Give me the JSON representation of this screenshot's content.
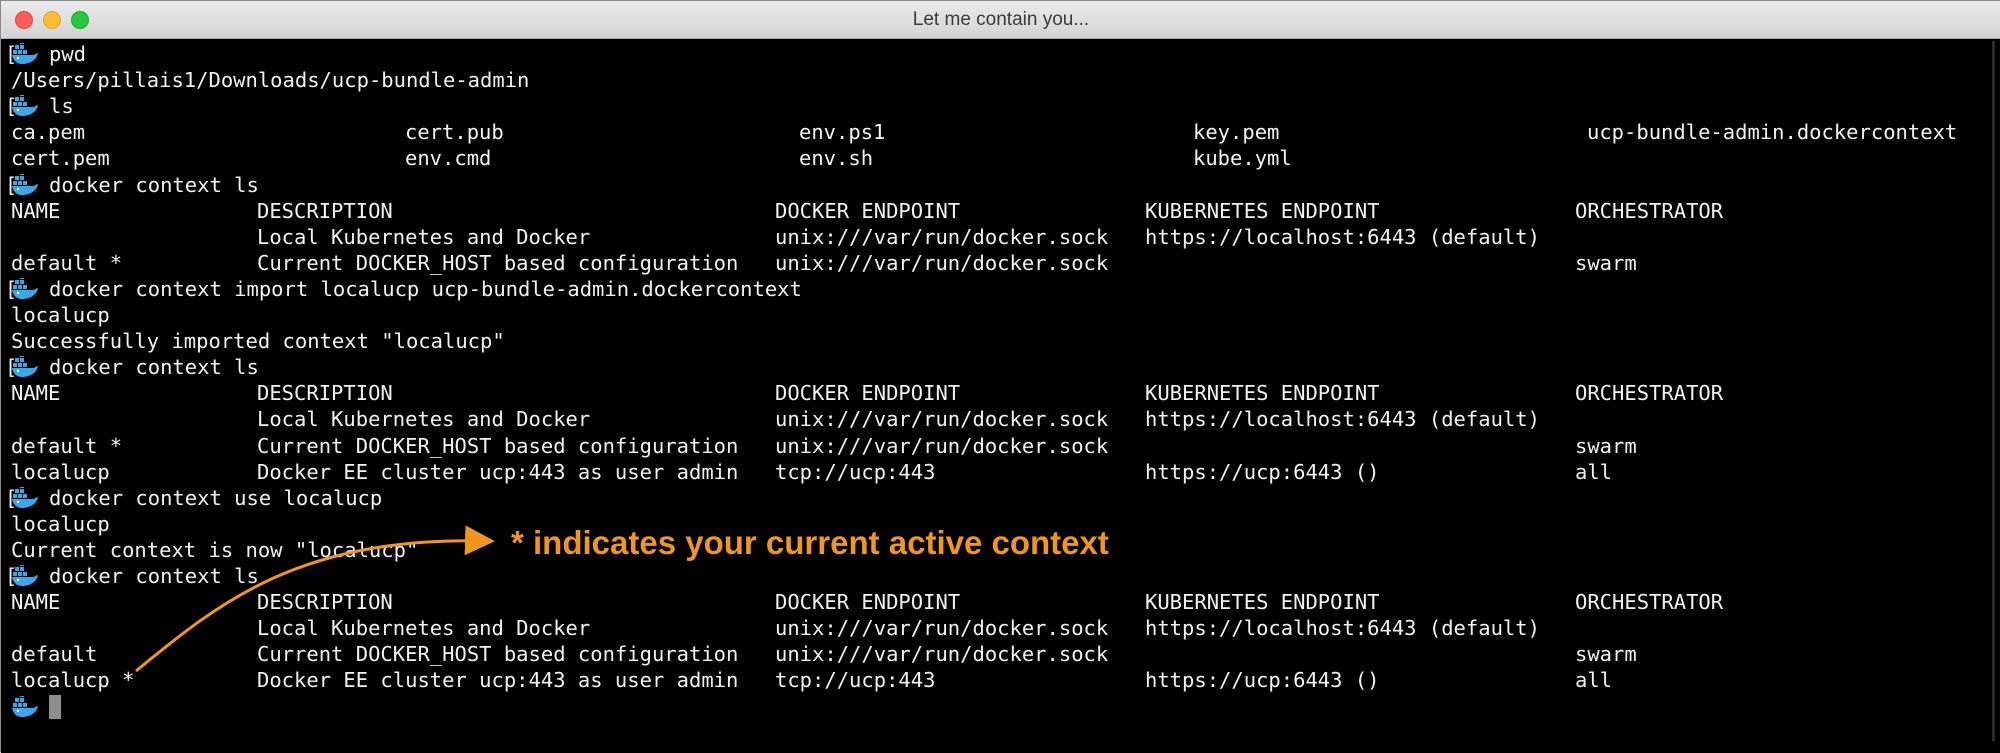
{
  "window": {
    "title": "Let me contain you..."
  },
  "prompt_icon": "docker-whale-icon",
  "session": [
    {
      "type": "cmd",
      "text": "pwd"
    },
    {
      "type": "out",
      "text": "/Users/pillais1/Downloads/ucp-bundle-admin"
    },
    {
      "type": "cmd",
      "text": "ls"
    },
    {
      "type": "cols",
      "cells": [
        "ca.pem",
        "cert.pub",
        "env.ps1",
        "key.pem",
        "ucp-bundle-admin.dockercontext"
      ]
    },
    {
      "type": "cols",
      "cells": [
        "cert.pem",
        "env.cmd",
        "env.sh",
        "kube.yml",
        ""
      ]
    },
    {
      "type": "cmd",
      "text": "docker context ls"
    },
    {
      "type": "ctx",
      "cells": [
        "NAME",
        "DESCRIPTION",
        "DOCKER ENDPOINT",
        "KUBERNETES ENDPOINT",
        "ORCHESTRATOR"
      ]
    },
    {
      "type": "ctx",
      "cells": [
        "",
        "Local Kubernetes and Docker",
        "unix:///var/run/docker.sock",
        "https://localhost:6443 (default)",
        ""
      ]
    },
    {
      "type": "ctx",
      "cells": [
        "default *",
        "Current DOCKER_HOST based configuration",
        "unix:///var/run/docker.sock",
        "",
        "swarm"
      ]
    },
    {
      "type": "cmd",
      "text": "docker context import localucp ucp-bundle-admin.dockercontext"
    },
    {
      "type": "out",
      "text": "localucp"
    },
    {
      "type": "out",
      "text": "Successfully imported context \"localucp\""
    },
    {
      "type": "cmd",
      "text": "docker context ls"
    },
    {
      "type": "ctx",
      "cells": [
        "NAME",
        "DESCRIPTION",
        "DOCKER ENDPOINT",
        "KUBERNETES ENDPOINT",
        "ORCHESTRATOR"
      ]
    },
    {
      "type": "ctx",
      "cells": [
        "",
        "Local Kubernetes and Docker",
        "unix:///var/run/docker.sock",
        "https://localhost:6443 (default)",
        ""
      ]
    },
    {
      "type": "ctx",
      "cells": [
        "default *",
        "Current DOCKER_HOST based configuration",
        "unix:///var/run/docker.sock",
        "",
        "swarm"
      ]
    },
    {
      "type": "ctx",
      "cells": [
        "localucp",
        "Docker EE cluster ucp:443 as user admin",
        "tcp://ucp:443",
        "https://ucp:6443 ()",
        "all"
      ]
    },
    {
      "type": "cmd",
      "text": "docker context use localucp"
    },
    {
      "type": "out",
      "text": "localucp"
    },
    {
      "type": "out",
      "text": "Current context is now \"localucp\""
    },
    {
      "type": "cmd",
      "text": "docker context ls"
    },
    {
      "type": "ctx",
      "cells": [
        "NAME",
        "DESCRIPTION",
        "DOCKER ENDPOINT",
        "KUBERNETES ENDPOINT",
        "ORCHESTRATOR"
      ]
    },
    {
      "type": "ctx",
      "cells": [
        "",
        "Local Kubernetes and Docker",
        "unix:///var/run/docker.sock",
        "https://localhost:6443 (default)",
        ""
      ]
    },
    {
      "type": "ctx",
      "cells": [
        "default",
        "Current DOCKER_HOST based configuration",
        "unix:///var/run/docker.sock",
        "",
        "swarm"
      ]
    },
    {
      "type": "ctx",
      "cells": [
        "localucp *",
        "Docker EE cluster ucp:443 as user admin",
        "tcp://ucp:443",
        "https://ucp:6443 ()",
        "all"
      ]
    },
    {
      "type": "prompt",
      "text": ""
    }
  ],
  "annotation": {
    "text": "* indicates your current active context",
    "color": "#f0961e"
  },
  "colors": {
    "terminal_bg": "#000000",
    "terminal_fg": "#f2f2f2",
    "cursor": "#8e8e8e"
  }
}
